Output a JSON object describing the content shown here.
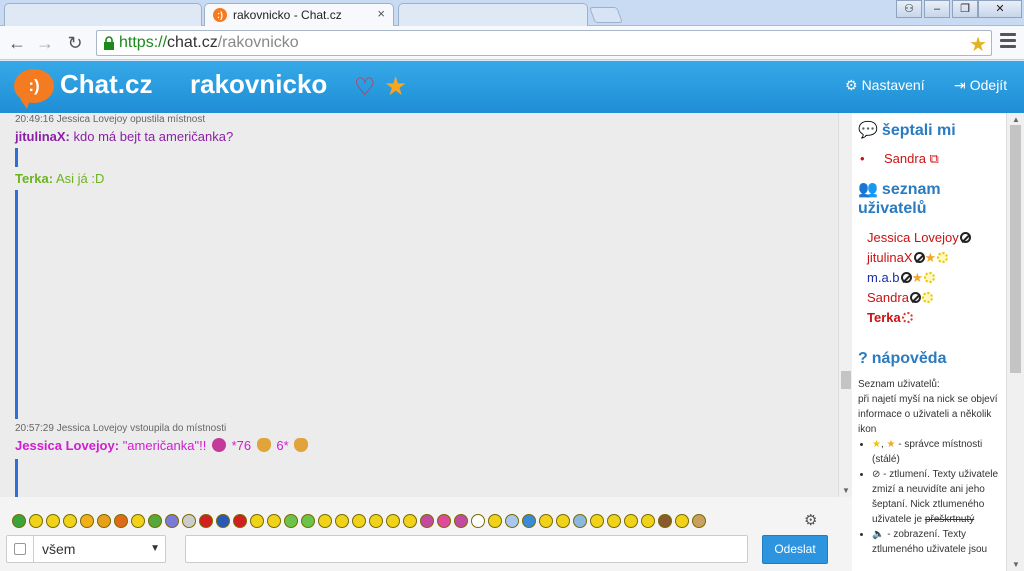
{
  "browser": {
    "tab_title": "rakovnicko - Chat.cz",
    "url_scheme": "https://",
    "url_host": "chat.cz",
    "url_path": "/rakovnicko"
  },
  "header": {
    "brand": "Chat.cz",
    "room": "rakovnicko",
    "settings": "Nastavení",
    "logout": "Odejít"
  },
  "messages": [
    {
      "kind": "system",
      "text": "20:49:16 Jessica Lovejoy opustila místnost"
    },
    {
      "kind": "chat",
      "nick": "jitulinaX:",
      "text": "kdo má bejt ta američanka?",
      "color": "#8b1fa8"
    },
    {
      "kind": "chat",
      "nick": "Terka:",
      "text": "Asi já :D",
      "color": "#6cb320"
    },
    {
      "kind": "system",
      "text": "20:57:29 Jessica Lovejoy vstoupila do místnosti"
    },
    {
      "kind": "chat",
      "nick": "Jessica Lovejoy:",
      "text_a": "\"američanka\"!!",
      "text_b": "*76",
      "text_c": "6*",
      "color": "#d21bd2"
    }
  ],
  "sidebar": {
    "whisper_heading": "šeptali mi",
    "whisper_user": "Sandra",
    "users_heading_1": "seznam",
    "users_heading_2": "uživatelů",
    "users": [
      {
        "name": "Jessica Lovejoy",
        "color": "#cc1111"
      },
      {
        "name": "jitulinaX",
        "color": "#cc1111"
      },
      {
        "name": "m.a.b",
        "color": "#1a2fa8"
      },
      {
        "name": "Sandra",
        "color": "#cc1111"
      },
      {
        "name": "Terka",
        "color": "#cc1111"
      }
    ],
    "help_heading": "nápověda",
    "help_intro_1": "Seznam uživatelů:",
    "help_intro_2": "při najetí myší na nick se objeví informace o uživateli a několik ikon",
    "help_item_1": "- správce místnosti (stálé)",
    "help_item_2a": "- ztlumení. Texty uživatele zmizí a neuvidíte ani jeho šeptaní. Nick ztlumeného uživatele je",
    "help_item_2b": "přeškrtnutý",
    "help_item_3": "- zobrazení. Texty ztlumeného uživatele jsou"
  },
  "composer": {
    "recipient": "všem",
    "send_label": "Odeslat"
  },
  "colors": {
    "accent": "#2d95e0",
    "header": "#1f8ed6",
    "brand_orange": "#f47b20"
  }
}
